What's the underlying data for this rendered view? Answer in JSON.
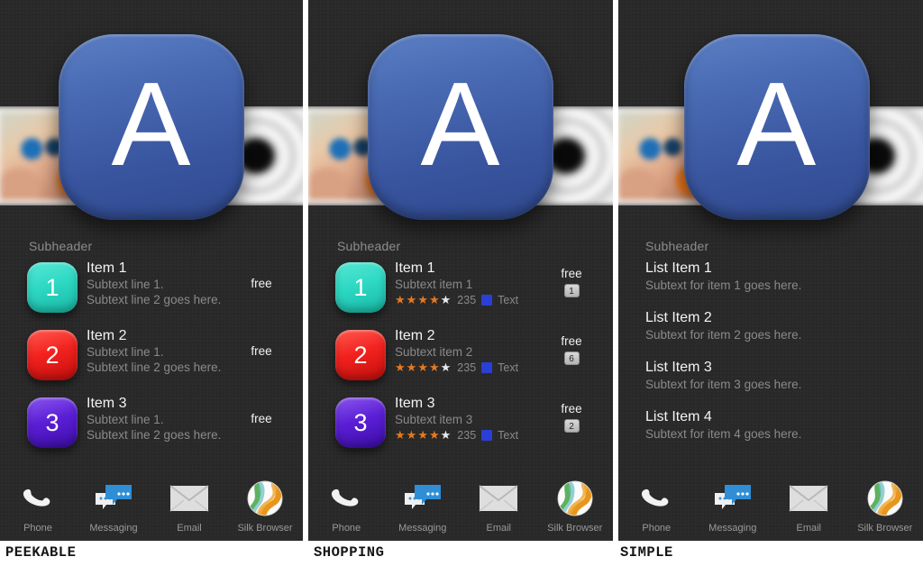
{
  "captions": [
    {
      "label": "PEEKABLE"
    },
    {
      "label": "SHOPPING"
    },
    {
      "label": "SIMPLE"
    }
  ],
  "colors": {
    "panel_background": "#2a2a2a",
    "app_icon_blue": "#3d59a6",
    "thumb_1": "#2ed9c3",
    "thumb_2": "#f2221f",
    "thumb_3": "#5b1fd6",
    "star_on": "#e8781e",
    "star_off": "#e9e9e9",
    "meta_square": "#2a3fd6",
    "title_text": "#f4f4f4",
    "subtext": "#8a8a8a"
  },
  "app_icon": {
    "glyph": "A"
  },
  "panels": {
    "peekable": {
      "subheader": "Subheader",
      "rows": [
        {
          "thumb_number": "1",
          "title": "Item 1",
          "sub_line_1": "Subtext line 1.",
          "sub_line_2": "Subtext line 2 goes here.",
          "price": "free"
        },
        {
          "thumb_number": "2",
          "title": "Item 2",
          "sub_line_1": "Subtext line 1.",
          "sub_line_2": "Subtext line 2 goes here.",
          "price": "free"
        },
        {
          "thumb_number": "3",
          "title": "Item 3",
          "sub_line_1": "Subtext line 1.",
          "sub_line_2": "Subtext line 2 goes here.",
          "price": "free"
        }
      ]
    },
    "shopping": {
      "subheader": "Subheader",
      "rows": [
        {
          "thumb_number": "1",
          "title": "Item 1",
          "sub_line_1": "Subtext item 1",
          "rating_filled": 4,
          "rating_total": 5,
          "rating_count": "235",
          "meta_label": "Text",
          "price": "free",
          "badge": "1"
        },
        {
          "thumb_number": "2",
          "title": "Item 2",
          "sub_line_1": "Subtext item 2",
          "rating_filled": 4,
          "rating_total": 5,
          "rating_count": "235",
          "meta_label": "Text",
          "price": "free",
          "badge": "6"
        },
        {
          "thumb_number": "3",
          "title": "Item 3",
          "sub_line_1": "Subtext item 3",
          "rating_filled": 4,
          "rating_total": 5,
          "rating_count": "235",
          "meta_label": "Text",
          "price": "free",
          "badge": "2"
        }
      ]
    },
    "simple": {
      "subheader": "Subheader",
      "rows": [
        {
          "title": "List Item 1",
          "sub": "Subtext for item 1 goes here."
        },
        {
          "title": "List Item 2",
          "sub": "Subtext for item 2 goes here."
        },
        {
          "title": "List Item 3",
          "sub": "Subtext for item 3 goes here."
        },
        {
          "title": "List Item  4",
          "sub": "Subtext for item 4 goes here."
        }
      ]
    }
  },
  "dock": {
    "items": [
      {
        "label": "Phone",
        "icon": "phone-handset-icon"
      },
      {
        "label": "Messaging",
        "icon": "chat-bubbles-icon"
      },
      {
        "label": "Email",
        "icon": "envelope-icon"
      },
      {
        "label": "Silk Browser",
        "icon": "silk-browser-sphere-icon"
      }
    ]
  }
}
